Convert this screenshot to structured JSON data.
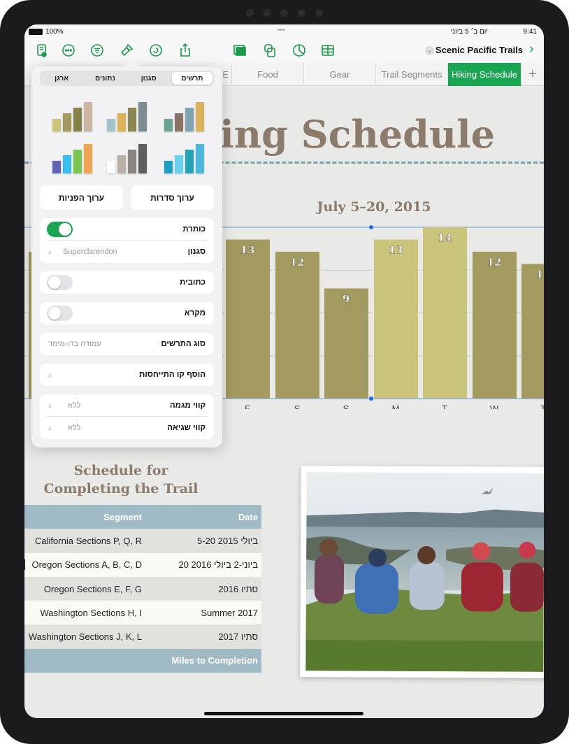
{
  "status_bar": {
    "battery": "100%",
    "date": "יום ב׳ 5 ביוני",
    "time": "9:41",
    "more": "•••"
  },
  "toolbar": {
    "document_title": "Scenic Pacific Trails",
    "icons": [
      "document-setup-icon",
      "more-icon",
      "organize-icon",
      "format-paintbrush-icon",
      "collaborate-icon",
      "share-icon",
      "media-icon",
      "shapes-icon",
      "chart-icon",
      "table-icon"
    ]
  },
  "sheet_tabs": {
    "items": [
      "E",
      "Food",
      "Gear",
      "Trail Segments",
      "Hiking Schedule"
    ],
    "active": "Hiking Schedule",
    "add": "+"
  },
  "canvas": {
    "title": "Hiking Schedule",
    "chart_subtitle": "July 5–20, 2015",
    "table_title_line1": "Schedule for",
    "table_title_line2": "Completing the Trail"
  },
  "format_popover": {
    "tabs": [
      "תרשים",
      "סגנון",
      "נתונים",
      "ארגן"
    ],
    "active_tab": "תרשים",
    "style_swatches": [
      [
        "#6aa292",
        "#8b7465",
        "#7fa3b1",
        "#d9b35d"
      ],
      [
        "#a6c2c8",
        "#dcb25b",
        "#8a8850",
        "#7b8d93"
      ],
      [
        "#cbc57c",
        "#a39a5f",
        "#858249",
        "#cdb6a3"
      ],
      [
        "#1aa0c8",
        "#6cd0ef",
        "#22a4b4",
        "#4bb8dc"
      ],
      [
        "#ffffff",
        "#b9b0a8",
        "#8a8580",
        "#5d5d5d"
      ],
      [
        "#6262b9",
        "#3bbdee",
        "#7ac651",
        "#eea44e"
      ]
    ],
    "edit_series": "ערוך סדרות",
    "edit_references": "ערוך הפניות",
    "title_label": "כותרת",
    "title_on": true,
    "font_label": "סגנון",
    "font_value": "Superclarendon",
    "caption_label": "כתובית",
    "caption_on": false,
    "legend_label": "מקרא",
    "legend_on": false,
    "chart_type_label": "סוג התרשים",
    "chart_type_value": "עמודה בדו-מימד",
    "add_reference_line": "הוסף קו התייחסות",
    "trendlines_label": "קווי מגמה",
    "trendlines_value": "ללא",
    "error_bars_label": "קווי שגיאה",
    "error_bars_value": "ללא"
  },
  "chart_data": {
    "type": "bar",
    "title": "July 5–20, 2015",
    "categories": [
      "",
      "F",
      "S",
      "S",
      "M",
      "T",
      "W",
      "T"
    ],
    "values": [
      12,
      13,
      12,
      9,
      13,
      14,
      12,
      11
    ],
    "highlight": [
      false,
      false,
      false,
      false,
      true,
      true,
      false,
      false
    ],
    "ylim": [
      0,
      14
    ],
    "grid": true,
    "legend": "none",
    "colors": {
      "bar": "#a39a5f",
      "highlight": "#cbc57c"
    }
  },
  "table": {
    "headers": [
      "Segment",
      "Date"
    ],
    "rows": [
      [
        "California Sections P, Q, R",
        "5-20 ביולי 2015"
      ],
      [
        "Oregon Sections A, B, C, D",
        "20 ביוני-2 ביולי 2016"
      ],
      [
        "Oregon Sections E, F, G",
        "סתיו 2016"
      ],
      [
        "Washington Sections H, I",
        "Summer 2017"
      ],
      [
        "Washington Sections J, K, L",
        "סתיו 2017"
      ]
    ],
    "footer": "Miles to Completion"
  },
  "colors": {
    "accent": "#1aa552",
    "title": "#8c7a6b",
    "table_header": "#a0bbc5"
  }
}
